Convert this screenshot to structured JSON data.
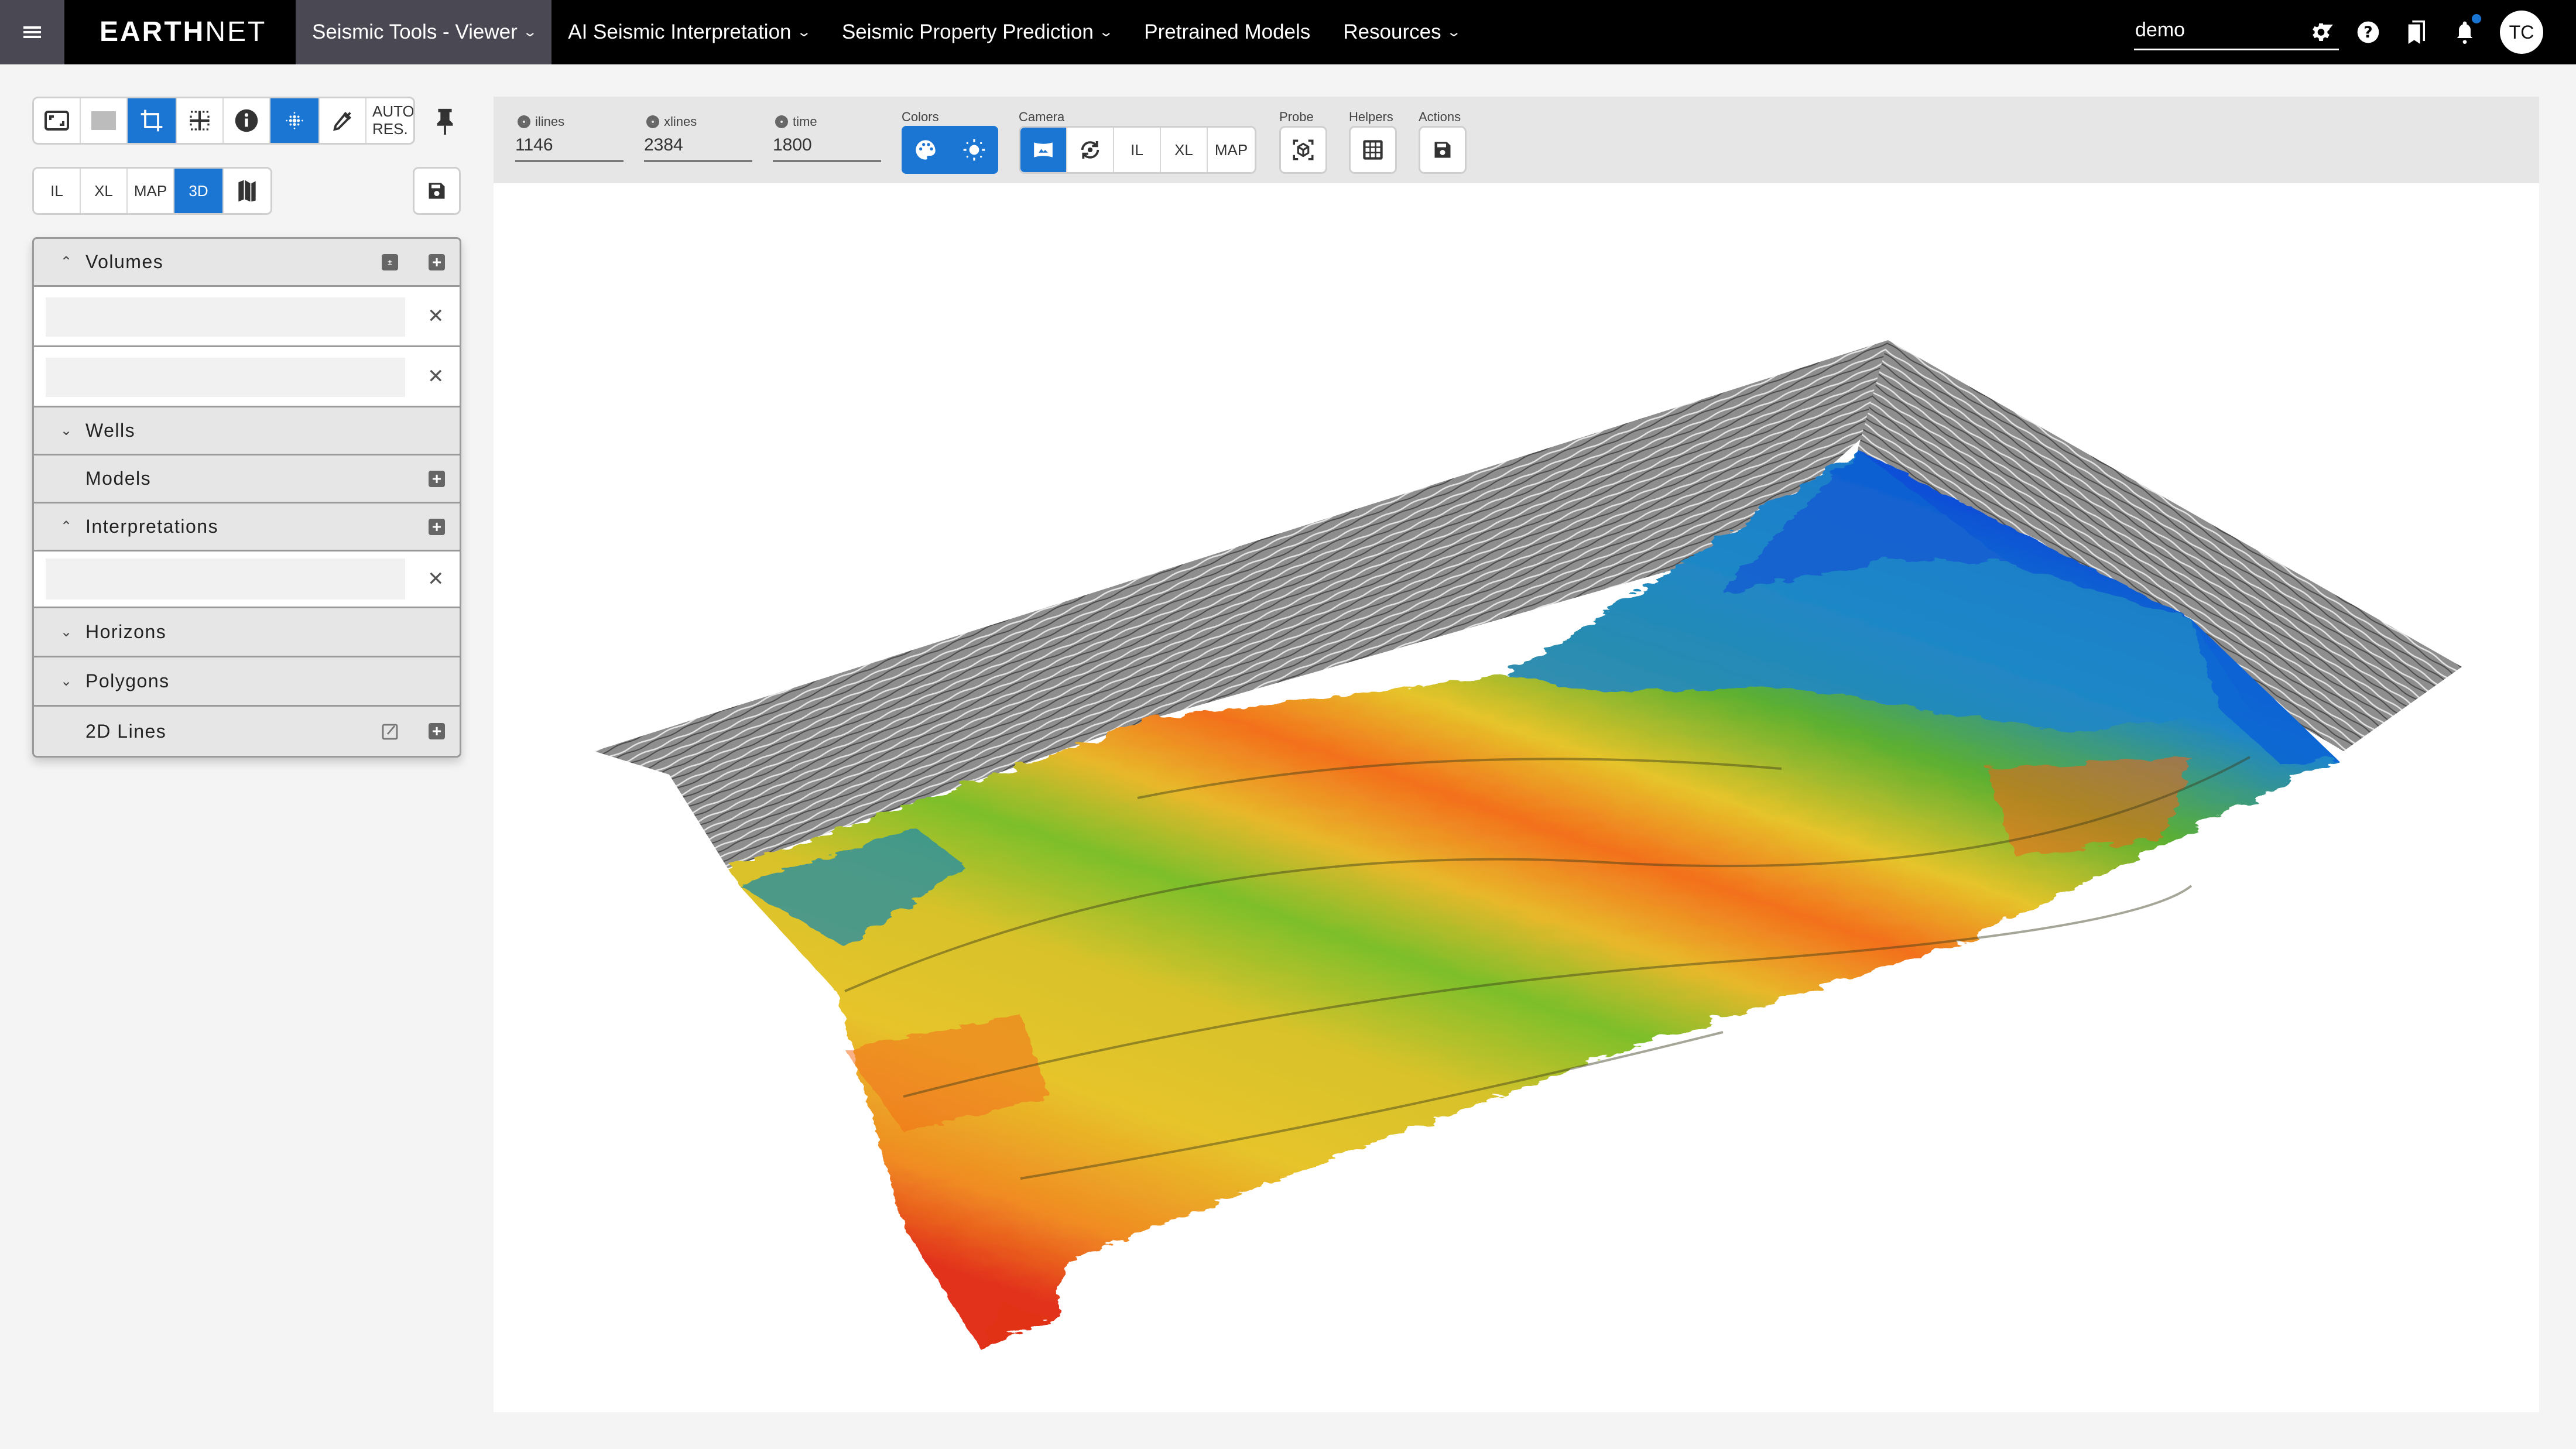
{
  "app": {
    "logo_bold": "EARTH",
    "logo_light": "NET"
  },
  "nav": {
    "items": [
      {
        "label": "Seismic Tools - Viewer",
        "dropdown": true,
        "active": true
      },
      {
        "label": "AI Seismic Interpretation",
        "dropdown": true,
        "active": false
      },
      {
        "label": "Seismic Property Prediction",
        "dropdown": true,
        "active": false
      },
      {
        "label": "Pretrained Models",
        "dropdown": false,
        "active": false
      },
      {
        "label": "Resources",
        "dropdown": true,
        "active": false
      }
    ],
    "project_select": "demo",
    "icons": [
      "gear-icon",
      "help-icon",
      "bookmarks-icon",
      "bell-icon"
    ],
    "notification_badge": true,
    "avatar_initials": "TC"
  },
  "sidebar": {
    "toolbar1": [
      {
        "icon": "fit-screen-icon",
        "active": false
      },
      {
        "icon": "gray-square-icon",
        "active": false
      },
      {
        "icon": "crop-icon",
        "active": true
      },
      {
        "icon": "grid-split-icon",
        "active": false
      },
      {
        "icon": "info-icon",
        "active": false
      },
      {
        "icon": "dots-pattern-icon",
        "active": true
      },
      {
        "icon": "eyedropper-icon",
        "active": false
      },
      {
        "label": "AUTO RES.",
        "active": false
      }
    ],
    "pin_icon": "pin-icon",
    "toolbar2": [
      {
        "label": "IL",
        "active": false
      },
      {
        "label": "XL",
        "active": false
      },
      {
        "label": "MAP",
        "active": false
      },
      {
        "label": "3D",
        "active": true
      },
      {
        "icon": "map-icon",
        "active": false
      }
    ],
    "save_icon": "save-icon",
    "layers": {
      "volumes": {
        "label": "Volumes",
        "expanded": true,
        "items": [
          "",
          ""
        ]
      },
      "wells": {
        "label": "Wells",
        "expanded": false
      },
      "models": {
        "label": "Models"
      },
      "interpretations": {
        "label": "Interpretations",
        "expanded": true,
        "items": [
          ""
        ]
      },
      "horizons": {
        "label": "Horizons",
        "expanded": false
      },
      "polygons": {
        "label": "Polygons",
        "expanded": false
      },
      "lines2d": {
        "label": "2D Lines"
      }
    }
  },
  "viewer": {
    "fields": [
      {
        "label": "ilines",
        "value": "1146"
      },
      {
        "label": "xlines",
        "value": "2384"
      },
      {
        "label": "time",
        "value": "1800"
      }
    ],
    "groups": {
      "colors": "Colors",
      "camera": "Camera",
      "probe": "Probe",
      "helpers": "Helpers",
      "actions": "Actions"
    },
    "camera_buttons": [
      {
        "icon": "panorama-icon",
        "active": true
      },
      {
        "icon": "rotate-icon",
        "active": false
      },
      {
        "label": "IL",
        "active": false
      },
      {
        "label": "XL",
        "active": false
      },
      {
        "label": "MAP",
        "active": false
      }
    ],
    "colors": {
      "accent": "#1b76d3",
      "surface_palette": [
        "#0b4fd6",
        "#1f86c8",
        "#2fa04a",
        "#7cbf2a",
        "#e6c42a",
        "#f39a22",
        "#f3621a",
        "#e2321a"
      ]
    }
  }
}
